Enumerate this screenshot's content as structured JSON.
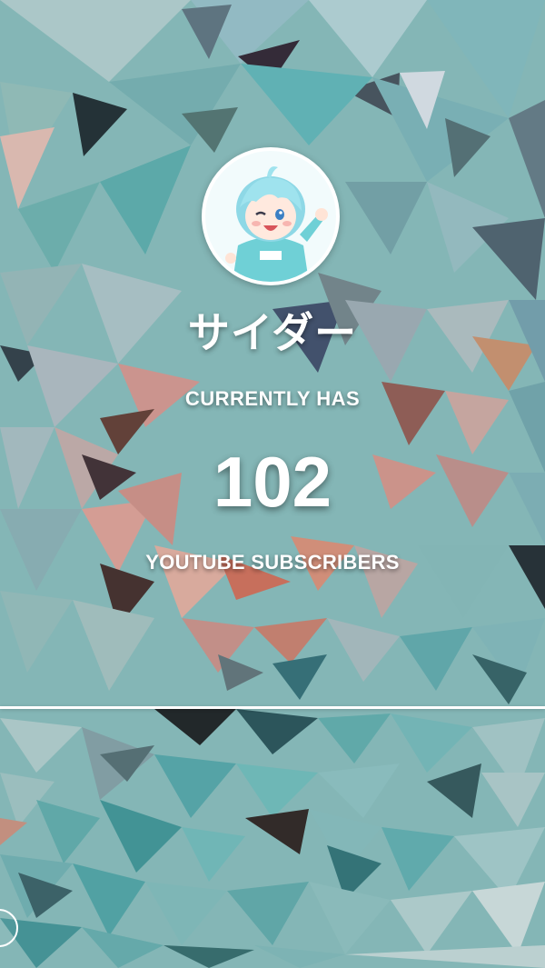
{
  "channel": {
    "name": "サイダー",
    "avatar_icon": "channel-avatar-anime-character"
  },
  "stats": {
    "caption_top": "CURRENTLY HAS",
    "subscriber_count": "102",
    "caption_bottom": "YOUTUBE SUBSCRIBERS"
  },
  "colors": {
    "text": "#ffffff",
    "background_teal": "#7fb4b3",
    "background_coral": "#c98f86"
  }
}
